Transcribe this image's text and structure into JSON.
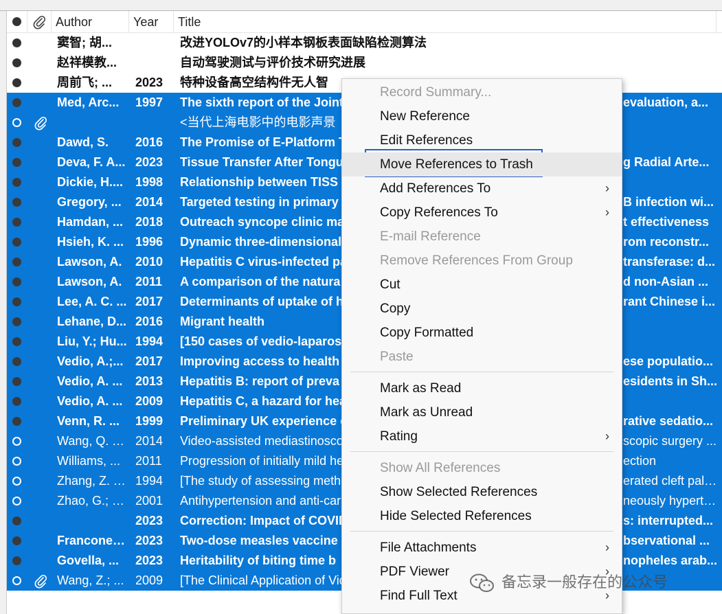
{
  "columns": {
    "read": "",
    "attach": "",
    "author": "Author",
    "year": "Year",
    "title": "Title"
  },
  "rows": [
    {
      "author": "窦智; 胡...",
      "year": "",
      "title": "改进YOLOv7的小样本钢板表面缺陷检测算法",
      "selected": false,
      "unread": true,
      "attachment": false
    },
    {
      "author": "赵祥模教...",
      "year": "",
      "title": "自动驾驶测试与评价技术研究进展",
      "selected": false,
      "unread": true,
      "attachment": false
    },
    {
      "author": "周前飞; ...",
      "year": "2023",
      "title": "特种设备高空结构件无人智",
      "selected": false,
      "unread": true,
      "attachment": false
    },
    {
      "author": "Med, Arc...",
      "year": "1997",
      "title": "The sixth report of the Joint",
      "title_end": "evaluation, a...",
      "selected": true,
      "unread": true,
      "attachment": false
    },
    {
      "author": "",
      "year": "",
      "title": "<当代上海电影中的电影声景",
      "selected": true,
      "unread": false,
      "attachment": true
    },
    {
      "author": "Dawd, S.",
      "year": "2016",
      "title": "The Promise of E-Platform T",
      "selected": true,
      "unread": true,
      "attachment": false
    },
    {
      "author": "Deva, F. A...",
      "year": "2023",
      "title": "Tissue Transfer After Tongu",
      "title_end": "g Radial Arte...",
      "selected": true,
      "unread": true,
      "attachment": false
    },
    {
      "author": "Dickie, H....",
      "year": "1998",
      "title": "Relationship between TISS a",
      "selected": true,
      "unread": true,
      "attachment": false
    },
    {
      "author": "Gregory, ...",
      "year": "2014",
      "title": "Targeted testing in primary",
      "title_end": "B infection wi...",
      "selected": true,
      "unread": true,
      "attachment": false
    },
    {
      "author": "Hamdan, ...",
      "year": "2018",
      "title": "Outreach syncope clinic ma",
      "title_end": "t effectiveness",
      "selected": true,
      "unread": true,
      "attachment": false
    },
    {
      "author": "Hsieh, K. ...",
      "year": "1996",
      "title": "Dynamic three-dimensional",
      "title_end": "rom reconstr...",
      "selected": true,
      "unread": true,
      "attachment": false
    },
    {
      "author": "Lawson, A.",
      "year": "2010",
      "title": "Hepatitis C virus-infected pa",
      "title_end": "transferase: d...",
      "selected": true,
      "unread": true,
      "attachment": false
    },
    {
      "author": "Lawson, A.",
      "year": "2011",
      "title": "A comparison of the natura",
      "title_end": "d non-Asian ...",
      "selected": true,
      "unread": true,
      "attachment": false
    },
    {
      "author": "Lee, A. C. ...",
      "year": "2017",
      "title": "Determinants of uptake of h",
      "title_end": "rant Chinese i...",
      "selected": true,
      "unread": true,
      "attachment": false
    },
    {
      "author": "Lehane, D...",
      "year": "2016",
      "title": "Migrant health",
      "selected": true,
      "unread": true,
      "attachment": false
    },
    {
      "author": "Liu, Y.; Hu...",
      "year": "1994",
      "title": "[150 cases of vedio-laparos",
      "selected": true,
      "unread": true,
      "attachment": false
    },
    {
      "author": "Vedio, A.;...",
      "year": "2017",
      "title": "Improving access to health",
      "title_end": "ese populatio...",
      "selected": true,
      "unread": true,
      "attachment": false
    },
    {
      "author": "Vedio, A. ...",
      "year": "2013",
      "title": "Hepatitis B: report of preva",
      "title_end": "esidents in Sh...",
      "selected": true,
      "unread": true,
      "attachment": false
    },
    {
      "author": "Vedio, A. ...",
      "year": "2009",
      "title": "Hepatitis C, a hazard for hea",
      "selected": true,
      "unread": true,
      "attachment": false
    },
    {
      "author": "Venn, R. ...",
      "year": "1999",
      "title": "Preliminary UK experience o",
      "title_end": "rative sedatio...",
      "selected": true,
      "unread": true,
      "attachment": false
    },
    {
      "author": "Wang, Q. Y...",
      "year": "2014",
      "title": "Video-assisted mediastinosco",
      "title_end": "scopic surgery ...",
      "selected": true,
      "unread": false,
      "attachment": false
    },
    {
      "author": "Williams, ...",
      "year": "2011",
      "title": "Progression of initially mild he",
      "title_end": "ection",
      "selected": true,
      "unread": false,
      "attachment": false
    },
    {
      "author": "Zhang, Z. Y...",
      "year": "1994",
      "title": "[The study of assessing metho",
      "title_end": "erated cleft pala...",
      "selected": true,
      "unread": false,
      "attachment": false
    },
    {
      "author": "Zhao, G.; Li...",
      "year": "2001",
      "title": "Antihypertension and anti-car",
      "title_end": "neously hyperte...",
      "selected": true,
      "unread": false,
      "attachment": false
    },
    {
      "author": "",
      "year": "2023",
      "title": "Correction: Impact of COVID",
      "title_end": "s: interrupted...",
      "selected": true,
      "unread": true,
      "attachment": false
    },
    {
      "author": "Franconer...",
      "year": "2023",
      "title": "Two-dose measles vaccine e",
      "title_end": "bservational ...",
      "selected": true,
      "unread": true,
      "attachment": false
    },
    {
      "author": "Govella, ...",
      "year": "2023",
      "title": "Heritability of biting time b",
      "title_end": "nopheles arab...",
      "selected": true,
      "unread": true,
      "attachment": false
    },
    {
      "author": "Wang, Z.; ...",
      "year": "2009",
      "title": "[The Clinical Application of Vid",
      "selected": true,
      "unread": false,
      "attachment": true
    }
  ],
  "context_menu": {
    "items": [
      {
        "label": "Record Summary...",
        "disabled": true,
        "submenu": false
      },
      {
        "label": "New Reference",
        "disabled": false,
        "submenu": false
      },
      {
        "label": "Edit References",
        "disabled": false,
        "submenu": false
      },
      {
        "label": "Move References to Trash",
        "disabled": false,
        "submenu": false,
        "highlighted": true
      },
      {
        "label": "Add References To",
        "disabled": false,
        "submenu": true
      },
      {
        "label": "Copy References To",
        "disabled": false,
        "submenu": true
      },
      {
        "label": "E-mail Reference",
        "disabled": true,
        "submenu": false
      },
      {
        "label": "Remove References From Group",
        "disabled": true,
        "submenu": false
      },
      {
        "label": "Cut",
        "disabled": false,
        "submenu": false
      },
      {
        "label": "Copy",
        "disabled": false,
        "submenu": false
      },
      {
        "label": "Copy Formatted",
        "disabled": false,
        "submenu": false
      },
      {
        "label": "Paste",
        "disabled": true,
        "submenu": false
      },
      {
        "label": "Mark as Read",
        "disabled": false,
        "submenu": false
      },
      {
        "label": "Mark as Unread",
        "disabled": false,
        "submenu": false
      },
      {
        "label": "Rating",
        "disabled": false,
        "submenu": true
      },
      {
        "label": "Show All References",
        "disabled": true,
        "submenu": false
      },
      {
        "label": "Show Selected References",
        "disabled": false,
        "submenu": false
      },
      {
        "label": "Hide Selected References",
        "disabled": false,
        "submenu": false
      },
      {
        "label": "File Attachments",
        "disabled": false,
        "submenu": true
      },
      {
        "label": "PDF Viewer",
        "disabled": false,
        "submenu": true
      },
      {
        "label": "Find Full Text",
        "disabled": false,
        "submenu": true
      }
    ],
    "submenu_glyph": "›"
  },
  "watermark": {
    "text": "备忘录一般存在的公众号"
  },
  "colors": {
    "selection": "#0a78d7",
    "focus_border": "#2b5fc8"
  }
}
